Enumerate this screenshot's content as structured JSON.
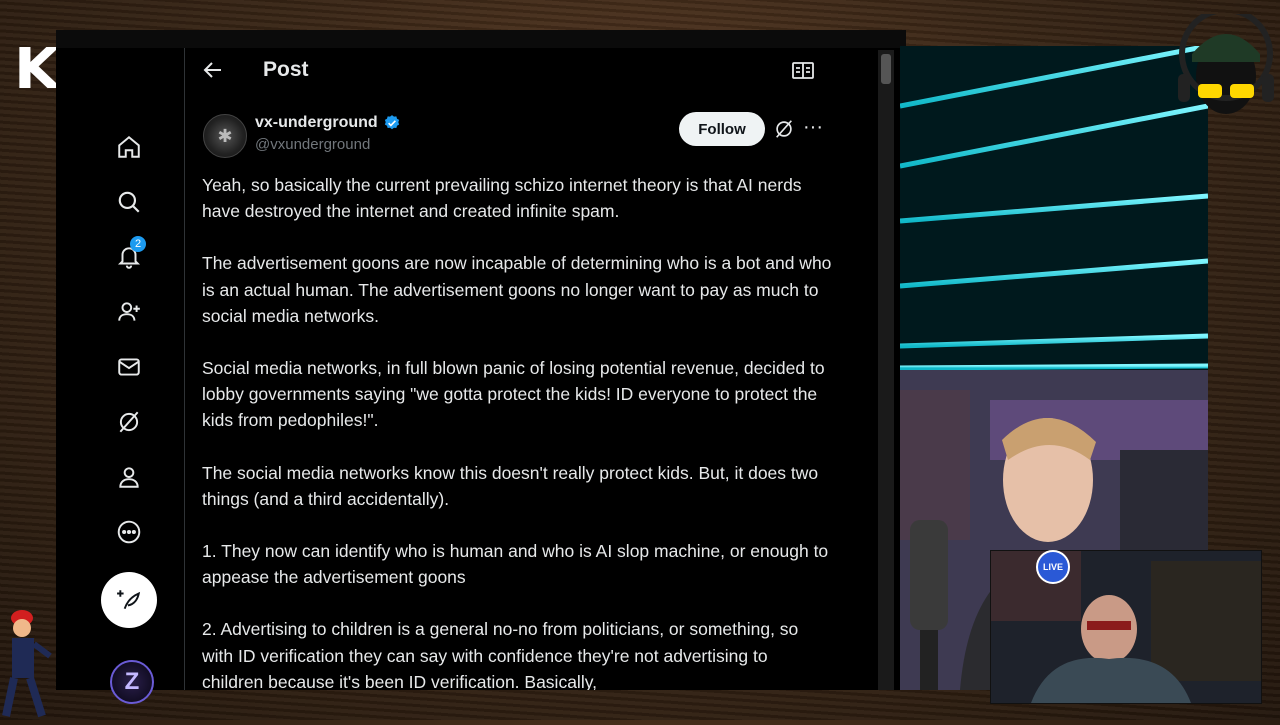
{
  "overlay": {
    "logo_text": "KICK",
    "live_badge": "LIVE"
  },
  "sidebar": {
    "items": [
      {
        "icon": "home-icon"
      },
      {
        "icon": "search-icon"
      },
      {
        "icon": "bell-icon",
        "badge": "2"
      },
      {
        "icon": "add-user-icon"
      },
      {
        "icon": "mail-icon"
      },
      {
        "icon": "grok-icon"
      },
      {
        "icon": "profile-icon"
      },
      {
        "icon": "more-circle-icon"
      }
    ],
    "compose_icon": "feather-plus-icon",
    "account_letter": "Z"
  },
  "header": {
    "title": "Post"
  },
  "post": {
    "display_name": "vx-underground",
    "handle": "@vxunderground",
    "follow_label": "Follow",
    "more_glyph": "···",
    "paragraphs": [
      "Yeah, so basically the current prevailing schizo internet theory is that AI nerds have destroyed the internet and created infinite spam.",
      "The advertisement goons are now incapable of determining who is a bot and who is an actual human. The advertisement goons no longer want to pay as much to social media networks.",
      "Social media networks, in full blown panic of losing potential revenue, decided to lobby governments saying \"we gotta protect the kids! ID everyone to protect the kids from pedophiles!\".",
      "The social media networks know this doesn't really protect kids. But, it does two things (and a third accidentally).",
      "1. They now can identify who is human and who is AI slop machine, or enough to appease the advertisement goons",
      "2. Advertising to children is a general no-no from politicians, or something, so with ID verification they can say with confidence they're not advertising to children because it's been ID verification. Basically,"
    ]
  },
  "colors": {
    "accent": "#1d9bf0",
    "background": "#000000",
    "text": "#e7e9ea",
    "muted": "#71767b",
    "grid_neon": "#22e0f0"
  }
}
